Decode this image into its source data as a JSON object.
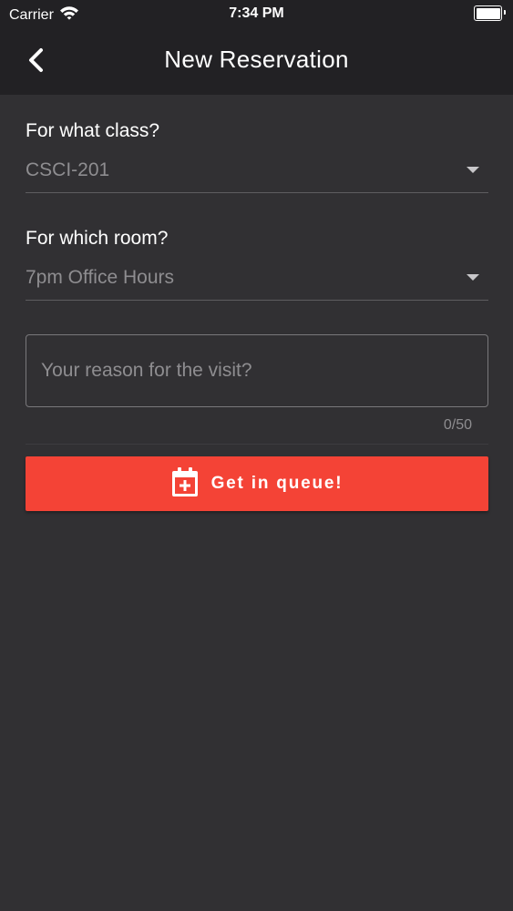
{
  "status_bar": {
    "carrier": "Carrier",
    "time": "7:34 PM",
    "wifi_icon": "wifi-icon",
    "battery_icon": "battery-icon"
  },
  "nav": {
    "title": "New Reservation",
    "back_icon": "chevron-left-icon"
  },
  "form": {
    "class_label": "For what class?",
    "class_value": "CSCI-201",
    "room_label": "For which room?",
    "room_value": "7pm Office Hours",
    "reason_placeholder": "Your reason for the visit?",
    "reason_value": "",
    "reason_counter": "0/50",
    "dropdown_icon": "caret-down-icon"
  },
  "submit": {
    "label": "Get in queue!",
    "icon": "calendar-plus-icon"
  },
  "colors": {
    "background": "#313033",
    "bars": "#222124",
    "accent": "#f44336"
  }
}
